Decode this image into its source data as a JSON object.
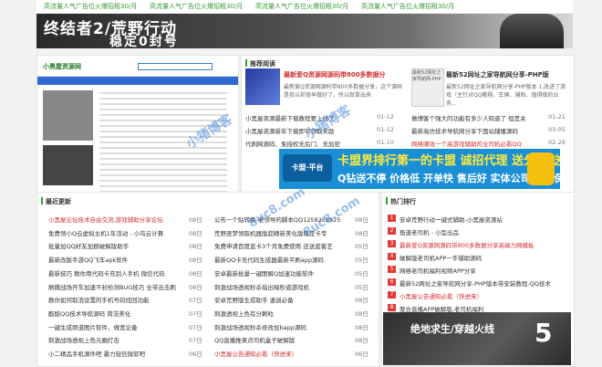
{
  "top_ads": [
    "高流量人气广告位火爆招租30/月",
    "高流量人气广告位火爆招租30/月",
    "高流量人气广告位火爆招租30/月",
    "高流量人气广告位火爆招租30/月"
  ],
  "banner": {
    "line1": "终结者2/荒野行动",
    "line2": "稳定0封号"
  },
  "site_shot": {
    "logo": "小黑屋资源网"
  },
  "recommend": {
    "title": "推荐阅读",
    "headline1": "最新爱Q资源网源码带800多数据分",
    "headline1_desc": "最新爱Q资源网源码带800多数据分享，这个源码是我以前很早做好了，所以就拿出来",
    "img2_text": "最新52网址之家导航网-PHP",
    "headline2": "最新52网址之家导航网分享-PHP版",
    "headline2_desc": "最新52网址之家导航网分享-PHP版本 1.改进了游戏（主针对QQ教程、车辆、辅助、值得做的业务...",
    "left_rows": [
      {
        "text": "小黑屋资源最新下载教程要上线了",
        "date": "01-12"
      },
      {
        "text": "小黑屋资源新年下载即可领取奖励",
        "date": "01-12"
      },
      {
        "text": "代刷网源码、免授权无后门、无加密",
        "date": "01-10"
      }
    ],
    "right_rows": [
      {
        "text": "做博客个强大的功能有多少人知道了 但是关",
        "date": "01-21"
      },
      {
        "text": "最新高仿技术导航网分享下面站辅播源码",
        "date": "03-05"
      },
      {
        "text": "网络赚钱一个高游戏辅助的全司机必看QQ",
        "date": "02-26"
      }
    ]
  },
  "big_ad": {
    "logo": "卡盟·平台",
    "line1": "卡盟界排行第一的卡盟 诚招代理 送分站 送Q钻",
    "line2": "Q钻送不停 价格低 开单快 售后好 实体公司 最强保障"
  },
  "latest": {
    "title": "最近更新",
    "left": [
      {
        "text": "小黑屋论坛技术自由交流,游戏辅助分享论坛.",
        "date": "08日",
        "red": true
      },
      {
        "text": "免费领小Q云虚拟主机1年活动 - 小鸟云计算",
        "date": "08日"
      },
      {
        "text": "批量加QQ好友加群破解版助手",
        "date": "08日"
      },
      {
        "text": "最新改版手游QQ飞车apk软件",
        "date": "08日"
      },
      {
        "text": "最新技巧 教你用代码卡充到人手机 微信代码",
        "date": "08日"
      },
      {
        "text": "刷撒战场开车加速不封检测BUG技巧 全带出击刷",
        "date": "08日"
      },
      {
        "text": "教你如何取消设置的手机号码找回功能",
        "date": "07日"
      },
      {
        "text": "酷酷QQ技术导航源码 简洁美化",
        "date": "07日"
      },
      {
        "text": "一键生成频道图片软件，做宽论备",
        "date": "07日"
      },
      {
        "text": "刺激战场透视上色元圈打击",
        "date": "07日"
      },
      {
        "text": "小二精品手机源件吧 暴力轻信微软吧",
        "date": "06日"
      }
    ],
    "right": [
      {
        "text": "公布一个贴转换-老领导的脚本QQ1258259925",
        "date": "08日"
      },
      {
        "text": "荒野逐梦领取机器版超精新美化版稳定卡专",
        "date": "08日"
      },
      {
        "text": "免费申请百度蓝卡3个月免费使用 还送蓝客艺",
        "date": "05日"
      },
      {
        "text": "最新QQ卡充代码生成器最新平刷app源码",
        "date": "05日"
      },
      {
        "text": "安卓最新批量一键图解Q加速功能软件",
        "date": "05日"
      },
      {
        "text": "刺激战场透视秒杀指出暗秒道游戏机",
        "date": "05日"
      },
      {
        "text": "安卓荒野版生成助手 速退必备",
        "date": "08日"
      },
      {
        "text": "刺激透视上色有分颗粒",
        "date": "08日"
      },
      {
        "text": "刺激战场透视秒杀修改加bapp源码",
        "date": "08日"
      },
      {
        "text": "QQ直播推来点司机盒子破解版",
        "date": "08日"
      },
      {
        "text": "小黑屋公告通知必看（快进来）",
        "date": "06日",
        "red": true
      }
    ]
  },
  "hot": {
    "title": "热门排行",
    "items": [
      {
        "num": "1",
        "text": "安卓荒野行动一键式辅助-小黑屋资源站",
        "red": false
      },
      {
        "num": "2",
        "text": "极速老司机 - 小型出品",
        "red": false
      },
      {
        "num": "3",
        "text": "最新爱Q资源网源码带800多数据分享高端力网模板",
        "red": true
      },
      {
        "num": "4",
        "text": "破解版老司机APP一手辅助源码",
        "red": false
      },
      {
        "num": "5",
        "text": "网络老司机福利视频APP分享",
        "red": false
      },
      {
        "num": "6",
        "text": "最新52网址之家导航网分享-PHP版本带安装教程-QQ技术",
        "red": false
      },
      {
        "num": "7",
        "text": "小黑屋公告通知必看（快进来）",
        "red": true
      },
      {
        "num": "8",
        "text": "聚合直播APP破解版,老司机福利",
        "red": false
      }
    ]
  },
  "game_ad": {
    "line1": "绝地求生/穿越火线",
    "line2": "5"
  },
  "watermark": {
    "brand": "小猪博客",
    "url": "8uc8.com"
  }
}
